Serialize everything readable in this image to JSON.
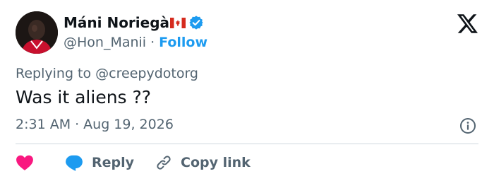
{
  "author": {
    "display_name": "Máni Noriegà",
    "flag_icon": "canada-flag-icon",
    "verified_icon": "verified-badge-icon",
    "handle": "@Hon_Manii",
    "separator": "·",
    "follow_label": "Follow"
  },
  "brand": {
    "logo_icon": "x-logo-icon"
  },
  "tweet": {
    "replying_prefix": "Replying to",
    "replying_to": "@creepydotorg",
    "text": "Was it aliens ??",
    "time": "2:31 AM",
    "separator": "·",
    "date": "Aug 19, 2026",
    "info_icon": "info-icon"
  },
  "actions": {
    "like_icon": "heart-icon",
    "reply_label": "Reply",
    "reply_icon": "speech-bubble-icon",
    "copy_label": "Copy link",
    "copy_icon": "link-icon"
  },
  "colors": {
    "accent": "#1d9bf0",
    "like": "#f91880",
    "text_primary": "#0f1419",
    "text_secondary": "#536471",
    "divider": "#cfd9de"
  }
}
